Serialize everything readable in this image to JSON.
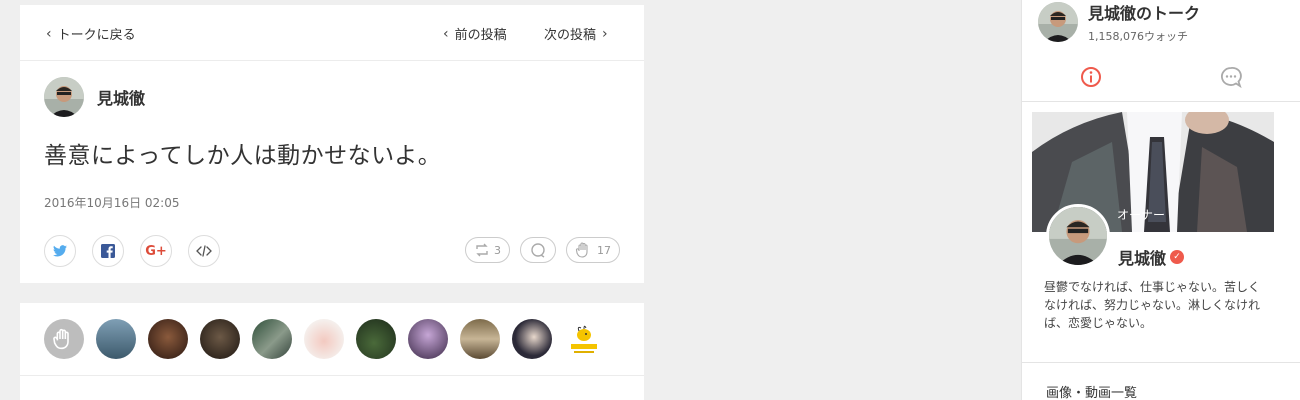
{
  "nav": {
    "back_label": "トークに戻る",
    "prev_label": "前の投稿",
    "next_label": "次の投稿"
  },
  "post": {
    "author_name": "見城徹",
    "message": "善意によってしか人は動かせないよ。",
    "timestamp": "2016年10月16日 02:05",
    "share_icons": [
      "twitter-icon",
      "facebook-icon",
      "google-plus-icon",
      "embed-icon"
    ],
    "google_plus_label": "G+",
    "repost_count": "3",
    "like_count": "17"
  },
  "likers": {
    "count_shown": "11"
  },
  "sidebar": {
    "talk_title": "見城徹のトーク",
    "watch_count": "1,158,076ウォッチ",
    "owner_label": "オーナー",
    "owner_name": "見城徹",
    "bio": "昼鬱でなければ、仕事じゃない。苦しくなければ、努力じゃない。淋しくなければ、恋愛じゃない。",
    "media_link": "画像・動画一覧"
  },
  "colors": {
    "accent_red": "#ef5a4c",
    "twitter": "#55acee",
    "facebook": "#3b5998",
    "google_plus": "#dd4b39"
  }
}
